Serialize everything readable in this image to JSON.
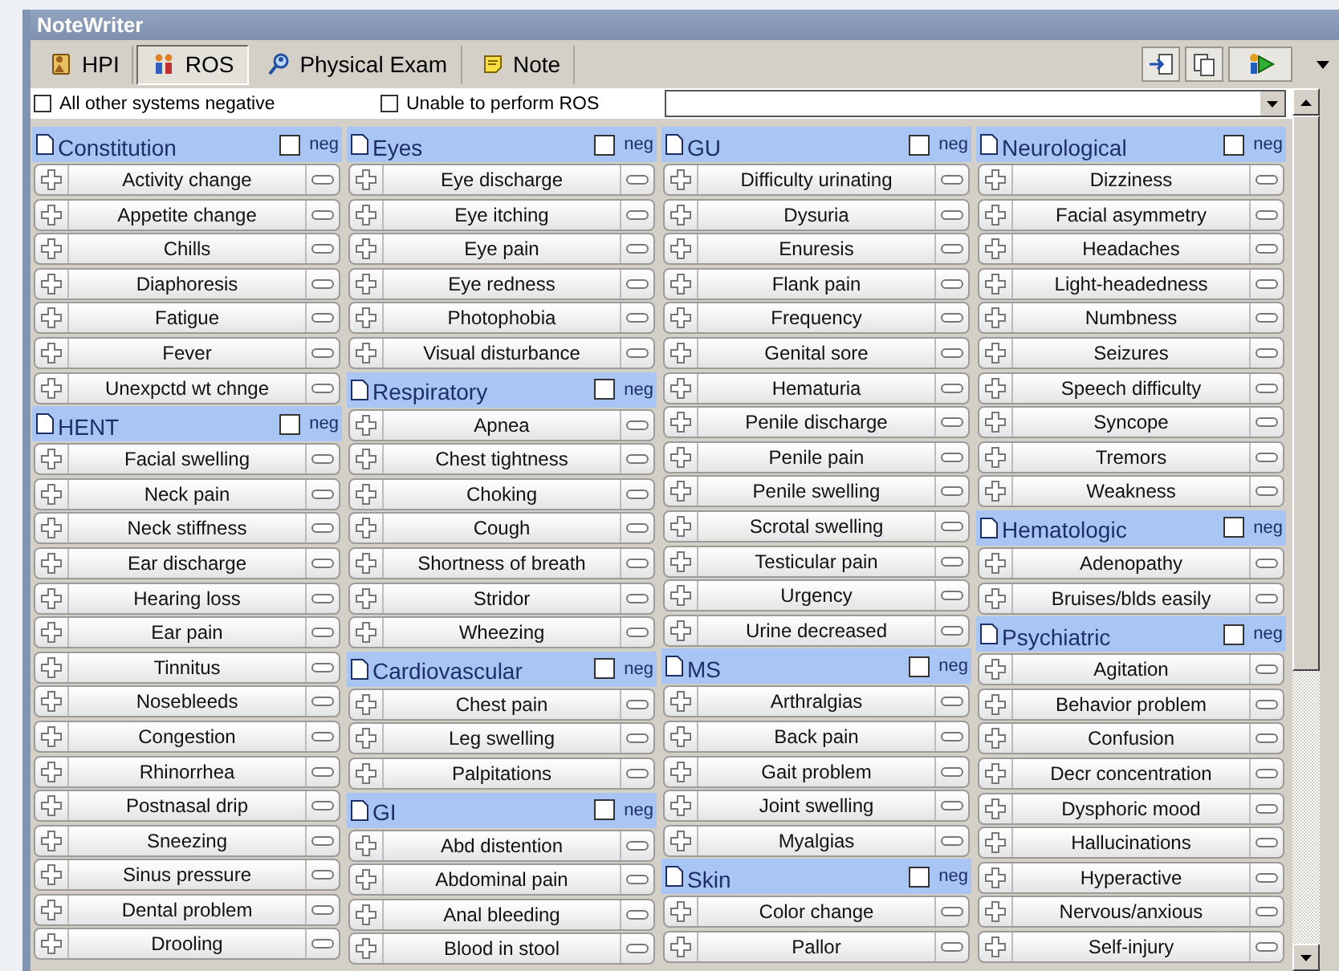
{
  "window": {
    "title": "NoteWriter"
  },
  "tabs": [
    {
      "label": "HPI",
      "selected": false
    },
    {
      "label": "ROS",
      "selected": true
    },
    {
      "label": "Physical Exam",
      "selected": false
    },
    {
      "label": "Note",
      "selected": false
    }
  ],
  "options": [
    {
      "label": "All other systems negative",
      "checked": false
    },
    {
      "label": "Unable to perform ROS",
      "checked": false
    }
  ],
  "columns": [
    {
      "sections": [
        {
          "title": "Constitution",
          "neg": false,
          "neg_label": "neg",
          "items": [
            "Activity change",
            "Appetite change",
            "Chills",
            "Diaphoresis",
            "Fatigue",
            "Fever",
            "Unexpctd wt chnge"
          ]
        },
        {
          "title": "HENT",
          "neg": false,
          "neg_label": "neg",
          "items": [
            "Facial swelling",
            "Neck pain",
            "Neck stiffness",
            "Ear discharge",
            "Hearing loss",
            "Ear pain",
            "Tinnitus",
            "Nosebleeds",
            "Congestion",
            "Rhinorrhea",
            "Postnasal drip",
            "Sneezing",
            "Sinus pressure",
            "Dental problem",
            "Drooling"
          ]
        }
      ]
    },
    {
      "sections": [
        {
          "title": "Eyes",
          "neg": false,
          "neg_label": "neg",
          "items": [
            "Eye discharge",
            "Eye itching",
            "Eye pain",
            "Eye redness",
            "Photophobia",
            "Visual disturbance"
          ]
        },
        {
          "title": "Respiratory",
          "neg": false,
          "neg_label": "neg",
          "items": [
            "Apnea",
            "Chest tightness",
            "Choking",
            "Cough",
            "Shortness of breath",
            "Stridor",
            "Wheezing"
          ]
        },
        {
          "title": "Cardiovascular",
          "neg": false,
          "neg_label": "neg",
          "items": [
            "Chest pain",
            "Leg swelling",
            "Palpitations"
          ]
        },
        {
          "title": "GI",
          "neg": false,
          "neg_label": "neg",
          "items": [
            "Abd distention",
            "Abdominal pain",
            "Anal bleeding",
            "Blood in stool"
          ]
        }
      ]
    },
    {
      "sections": [
        {
          "title": "GU",
          "neg": false,
          "neg_label": "neg",
          "items": [
            "Difficulty urinating",
            "Dysuria",
            "Enuresis",
            "Flank pain",
            "Frequency",
            "Genital sore",
            "Hematuria",
            "Penile discharge",
            "Penile pain",
            "Penile swelling",
            "Scrotal swelling",
            "Testicular pain",
            "Urgency",
            "Urine decreased"
          ]
        },
        {
          "title": "MS",
          "neg": false,
          "neg_label": "neg",
          "items": [
            "Arthralgias",
            "Back pain",
            "Gait problem",
            "Joint swelling",
            "Myalgias"
          ]
        },
        {
          "title": "Skin",
          "neg": false,
          "neg_label": "neg",
          "items": [
            "Color change",
            "Pallor"
          ]
        }
      ]
    },
    {
      "sections": [
        {
          "title": "Neurological",
          "neg": false,
          "neg_label": "neg",
          "items": [
            "Dizziness",
            "Facial asymmetry",
            "Headaches",
            "Light-headedness",
            "Numbness",
            "Seizures",
            "Speech difficulty",
            "Syncope",
            "Tremors",
            "Weakness"
          ]
        },
        {
          "title": "Hematologic",
          "neg": false,
          "neg_label": "neg",
          "items": [
            "Adenopathy",
            "Bruises/blds easily"
          ]
        },
        {
          "title": "Psychiatric",
          "neg": false,
          "neg_label": "neg",
          "items": [
            "Agitation",
            "Behavior problem",
            "Confusion",
            "Decr concentration",
            "Dysphoric mood",
            "Hallucinations",
            "Hyperactive",
            "Nervous/anxious",
            "Self-injury"
          ]
        }
      ]
    }
  ]
}
